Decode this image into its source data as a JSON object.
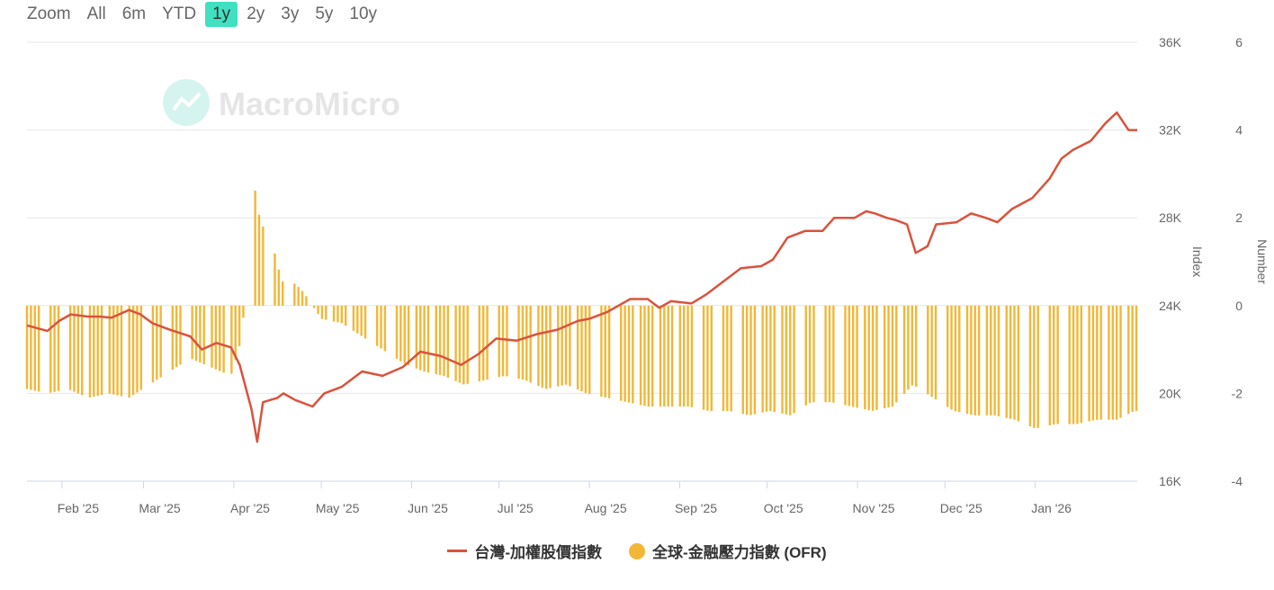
{
  "zoom": {
    "label": "Zoom",
    "buttons": [
      "All",
      "6m",
      "YTD",
      "1y",
      "2y",
      "3y",
      "5y",
      "10y"
    ],
    "active": "1y"
  },
  "watermark": "MacroMicro",
  "chart_data": {
    "type": "line+bar",
    "x_ticks": [
      "Feb '25",
      "Mar '25",
      "Apr '25",
      "May '25",
      "Jun '25",
      "Jul '25",
      "Aug '25",
      "Sep '25",
      "Oct '25",
      "Nov '25",
      "Dec '25",
      "Jan '26"
    ],
    "y_left": {
      "label": "Index",
      "ticks": [
        "36K",
        "32K",
        "28K",
        "24K",
        "20K",
        "16K"
      ],
      "range": [
        16000,
        36000
      ]
    },
    "y_right": {
      "label": "Number",
      "ticks": [
        "6",
        "4",
        "2",
        "0",
        "-2",
        "-4"
      ],
      "range": [
        -4,
        6
      ]
    },
    "grid": true,
    "series": [
      {
        "name": "台灣-加權股價指數",
        "type": "line",
        "color": "#d9533c",
        "axis": "left",
        "points": [
          [
            "2025-01-20",
            23100
          ],
          [
            "2025-01-27",
            22850
          ],
          [
            "2025-01-31",
            23300
          ],
          [
            "2025-02-04",
            23600
          ],
          [
            "2025-02-10",
            23500
          ],
          [
            "2025-02-14",
            23500
          ],
          [
            "2025-02-18",
            23450
          ],
          [
            "2025-02-24",
            23800
          ],
          [
            "2025-02-28",
            23600
          ],
          [
            "2025-03-04",
            23200
          ],
          [
            "2025-03-10",
            22900
          ],
          [
            "2025-03-17",
            22600
          ],
          [
            "2025-03-21",
            22000
          ],
          [
            "2025-03-26",
            22300
          ],
          [
            "2025-03-31",
            22100
          ],
          [
            "2025-04-03",
            21300
          ],
          [
            "2025-04-07",
            19300
          ],
          [
            "2025-04-09",
            17800
          ],
          [
            "2025-04-11",
            19600
          ],
          [
            "2025-04-16",
            19800
          ],
          [
            "2025-04-18",
            20000
          ],
          [
            "2025-04-22",
            19700
          ],
          [
            "2025-04-28",
            19400
          ],
          [
            "2025-05-02",
            20000
          ],
          [
            "2025-05-08",
            20300
          ],
          [
            "2025-05-15",
            21000
          ],
          [
            "2025-05-22",
            20800
          ],
          [
            "2025-05-29",
            21200
          ],
          [
            "2025-06-04",
            21900
          ],
          [
            "2025-06-11",
            21700
          ],
          [
            "2025-06-18",
            21300
          ],
          [
            "2025-06-24",
            21800
          ],
          [
            "2025-06-30",
            22500
          ],
          [
            "2025-07-07",
            22400
          ],
          [
            "2025-07-14",
            22700
          ],
          [
            "2025-07-21",
            22900
          ],
          [
            "2025-07-28",
            23300
          ],
          [
            "2025-08-01",
            23400
          ],
          [
            "2025-08-07",
            23700
          ],
          [
            "2025-08-11",
            24000
          ],
          [
            "2025-08-15",
            24300
          ],
          [
            "2025-08-21",
            24300
          ],
          [
            "2025-08-25",
            23900
          ],
          [
            "2025-08-29",
            24200
          ],
          [
            "2025-09-05",
            24100
          ],
          [
            "2025-09-10",
            24500
          ],
          [
            "2025-09-15",
            25000
          ],
          [
            "2025-09-22",
            25700
          ],
          [
            "2025-09-29",
            25800
          ],
          [
            "2025-10-03",
            26100
          ],
          [
            "2025-10-08",
            27100
          ],
          [
            "2025-10-14",
            27400
          ],
          [
            "2025-10-20",
            27400
          ],
          [
            "2025-10-24",
            28000
          ],
          [
            "2025-10-31",
            28000
          ],
          [
            "2025-11-04",
            28300
          ],
          [
            "2025-11-07",
            28200
          ],
          [
            "2025-11-11",
            28000
          ],
          [
            "2025-11-14",
            27900
          ],
          [
            "2025-11-18",
            27700
          ],
          [
            "2025-11-21",
            26400
          ],
          [
            "2025-11-25",
            26700
          ],
          [
            "2025-11-28",
            27700
          ],
          [
            "2025-12-05",
            27800
          ],
          [
            "2025-12-10",
            28200
          ],
          [
            "2025-12-15",
            28000
          ],
          [
            "2025-12-19",
            27800
          ],
          [
            "2025-12-24",
            28400
          ],
          [
            "2025-12-31",
            28900
          ],
          [
            "2026-01-06",
            29800
          ],
          [
            "2026-01-10",
            30700
          ],
          [
            "2026-01-14",
            31100
          ],
          [
            "2026-01-20",
            31500
          ],
          [
            "2026-01-25",
            32300
          ],
          [
            "2026-01-29",
            32800
          ],
          [
            "2026-02-02",
            32000
          ],
          [
            "2026-02-05",
            32000
          ]
        ]
      },
      {
        "name": "全球-金融壓力指數 (OFR)",
        "type": "column",
        "color": "#f2b737",
        "axis": "right",
        "points": [
          [
            "2025-01-20",
            -1.9
          ],
          [
            "2025-01-27",
            -2.0
          ],
          [
            "2025-02-03",
            -1.9
          ],
          [
            "2025-02-10",
            -2.1
          ],
          [
            "2025-02-17",
            -2.0
          ],
          [
            "2025-02-24",
            -2.1
          ],
          [
            "2025-03-03",
            -1.8
          ],
          [
            "2025-03-10",
            -1.5
          ],
          [
            "2025-03-17",
            -1.2
          ],
          [
            "2025-03-24",
            -1.4
          ],
          [
            "2025-03-31",
            -1.6
          ],
          [
            "2025-04-03",
            -0.9
          ],
          [
            "2025-04-07",
            1.1
          ],
          [
            "2025-04-08",
            2.8
          ],
          [
            "2025-04-09",
            2.2
          ],
          [
            "2025-04-11",
            1.8
          ],
          [
            "2025-04-14",
            1.5
          ],
          [
            "2025-04-16",
            0.9
          ],
          [
            "2025-04-18",
            0.5
          ],
          [
            "2025-04-22",
            0.5
          ],
          [
            "2025-04-25",
            0.3
          ],
          [
            "2025-05-01",
            -0.3
          ],
          [
            "2025-05-08",
            -0.4
          ],
          [
            "2025-05-15",
            -0.7
          ],
          [
            "2025-05-22",
            -1.0
          ],
          [
            "2025-05-29",
            -1.3
          ],
          [
            "2025-06-05",
            -1.5
          ],
          [
            "2025-06-12",
            -1.6
          ],
          [
            "2025-06-19",
            -1.8
          ],
          [
            "2025-06-26",
            -1.7
          ],
          [
            "2025-07-03",
            -1.6
          ],
          [
            "2025-07-10",
            -1.7
          ],
          [
            "2025-07-17",
            -1.9
          ],
          [
            "2025-07-24",
            -1.8
          ],
          [
            "2025-07-31",
            -2.0
          ],
          [
            "2025-08-07",
            -2.1
          ],
          [
            "2025-08-14",
            -2.2
          ],
          [
            "2025-08-21",
            -2.3
          ],
          [
            "2025-08-28",
            -2.3
          ],
          [
            "2025-09-04",
            -2.3
          ],
          [
            "2025-09-11",
            -2.4
          ],
          [
            "2025-09-18",
            -2.4
          ],
          [
            "2025-09-25",
            -2.5
          ],
          [
            "2025-10-02",
            -2.4
          ],
          [
            "2025-10-09",
            -2.5
          ],
          [
            "2025-10-16",
            -2.2
          ],
          [
            "2025-10-23",
            -2.2
          ],
          [
            "2025-10-30",
            -2.3
          ],
          [
            "2025-11-06",
            -2.4
          ],
          [
            "2025-11-13",
            -2.3
          ],
          [
            "2025-11-20",
            -1.8
          ],
          [
            "2025-11-27",
            -2.1
          ],
          [
            "2025-12-04",
            -2.4
          ],
          [
            "2025-12-11",
            -2.5
          ],
          [
            "2025-12-18",
            -2.5
          ],
          [
            "2025-12-25",
            -2.6
          ],
          [
            "2026-01-01",
            -2.8
          ],
          [
            "2026-01-08",
            -2.7
          ],
          [
            "2026-01-15",
            -2.7
          ],
          [
            "2026-01-22",
            -2.6
          ],
          [
            "2026-01-29",
            -2.6
          ],
          [
            "2026-02-04",
            -2.4
          ]
        ]
      }
    ]
  }
}
